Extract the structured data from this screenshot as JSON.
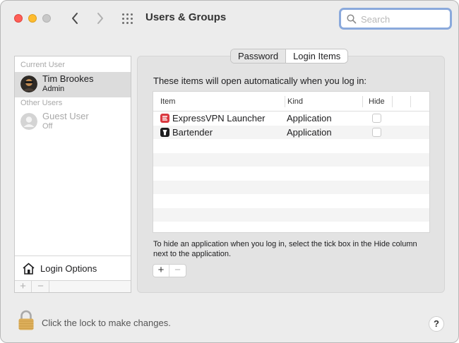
{
  "window": {
    "title": "Users & Groups",
    "search_placeholder": "Search"
  },
  "sidebar": {
    "current_user_label": "Current User",
    "other_users_label": "Other Users",
    "users": [
      {
        "name": "Tim Brookes",
        "role": "Admin",
        "selected": true
      },
      {
        "name": "Guest User",
        "role": "Off",
        "selected": false
      }
    ],
    "login_options_label": "Login Options",
    "add_button": "+",
    "remove_button": "−"
  },
  "tabs": [
    {
      "label": "Password",
      "active": false
    },
    {
      "label": "Login Items",
      "active": true
    }
  ],
  "login_items": {
    "intro": "These items will open automatically when you log in:",
    "columns": [
      "Item",
      "Kind",
      "Hide"
    ],
    "rows": [
      {
        "item": "ExpressVPN Launcher",
        "kind": "Application",
        "hide": false,
        "icon": "expressvpn-icon"
      },
      {
        "item": "Bartender",
        "kind": "Application",
        "hide": false,
        "icon": "bartender-icon"
      }
    ],
    "hint": "To hide an application when you log in, select the tick box in the Hide column next to the application.",
    "add_button": "+",
    "remove_button": "−"
  },
  "footer": {
    "lock_text": "Click the lock to make changes.",
    "help_label": "?"
  },
  "colors": {
    "close": "#ff5f57",
    "minimize": "#febc2e",
    "focus_ring": "#8aa9dc",
    "expressvpn": "#da3940"
  }
}
